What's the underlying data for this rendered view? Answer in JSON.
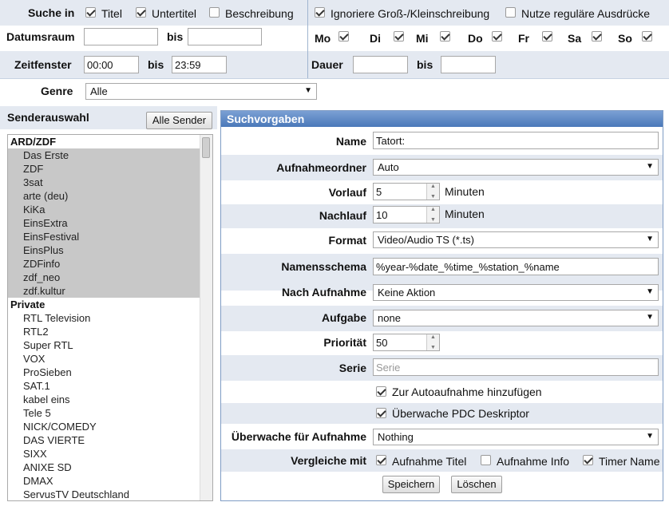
{
  "search": {
    "suche_in_label": "Suche in",
    "titel": {
      "label": "Titel",
      "checked": true
    },
    "untertitel": {
      "label": "Untertitel",
      "checked": true
    },
    "beschreibung": {
      "label": "Beschreibung",
      "checked": false
    },
    "ignore_case": {
      "label": "Ignoriere Groß-/Kleinschreibung",
      "checked": true
    },
    "regex": {
      "label": "Nutze reguläre Ausdrücke",
      "checked": false
    },
    "datumsraum_label": "Datumsraum",
    "bis": "bis",
    "date_from": "",
    "date_to": "",
    "weekdays": [
      {
        "label": "Mo",
        "checked": true
      },
      {
        "label": "Di",
        "checked": true
      },
      {
        "label": "Mi",
        "checked": true
      },
      {
        "label": "Do",
        "checked": true
      },
      {
        "label": "Fr",
        "checked": true
      },
      {
        "label": "Sa",
        "checked": true
      },
      {
        "label": "So",
        "checked": true
      }
    ],
    "zeitfenster_label": "Zeitfenster",
    "time_from": "00:00",
    "time_to": "23:59",
    "dauer_label": "Dauer",
    "dauer_from": "",
    "dauer_to": "",
    "genre_label": "Genre",
    "genre_value": "Alle"
  },
  "senders": {
    "title": "Senderauswahl",
    "all_button": "Alle Sender",
    "groups": [
      {
        "name": "ARD/ZDF",
        "items": [
          "Das Erste",
          "ZDF",
          "3sat",
          "arte (deu)",
          "KiKa",
          "EinsExtra",
          "EinsFestival",
          "EinsPlus",
          "ZDFinfo",
          "zdf_neo",
          "zdf.kultur"
        ]
      },
      {
        "name": "Private",
        "items": [
          "RTL Television",
          "RTL2",
          "Super RTL",
          "VOX",
          "ProSieben",
          "SAT.1",
          "kabel eins",
          "Tele 5",
          "NICK/COMEDY",
          "DAS VIERTE",
          "SIXX",
          "ANIXE SD",
          "DMAX",
          "ServusTV Deutschland"
        ]
      }
    ]
  },
  "panel": {
    "title": "Suchvorgaben",
    "name_label": "Name",
    "name_value": "Tatort:",
    "folder_label": "Aufnahmeordner",
    "folder_value": "Auto",
    "vorlauf_label": "Vorlauf",
    "vorlauf_value": "5",
    "nachlauf_label": "Nachlauf",
    "nachlauf_value": "10",
    "minuten": "Minuten",
    "format_label": "Format",
    "format_value": "Video/Audio TS (*.ts)",
    "schema_label": "Namensschema",
    "schema_value": "%year-%date_%time_%station_%name",
    "after_label": "Nach Aufnahme",
    "after_value": "Keine Aktion",
    "task_label": "Aufgabe",
    "task_value": "none",
    "prio_label": "Priorität",
    "prio_value": "50",
    "serie_label": "Serie",
    "serie_placeholder": "Serie",
    "auto_add": {
      "label": "Zur Autoaufnahme hinzufügen",
      "checked": true
    },
    "pdc": {
      "label": "Überwache PDC Deskriptor",
      "checked": true
    },
    "watch_label": "Überwache für Aufnahme",
    "watch_value": "Nothing",
    "compare_label": "Vergleiche mit",
    "cmp_title": {
      "label": "Aufnahme Titel",
      "checked": true
    },
    "cmp_info": {
      "label": "Aufnahme Info",
      "checked": false
    },
    "cmp_timer": {
      "label": "Timer Name",
      "checked": true
    },
    "save_button": "Speichern",
    "delete_button": "Löschen"
  }
}
